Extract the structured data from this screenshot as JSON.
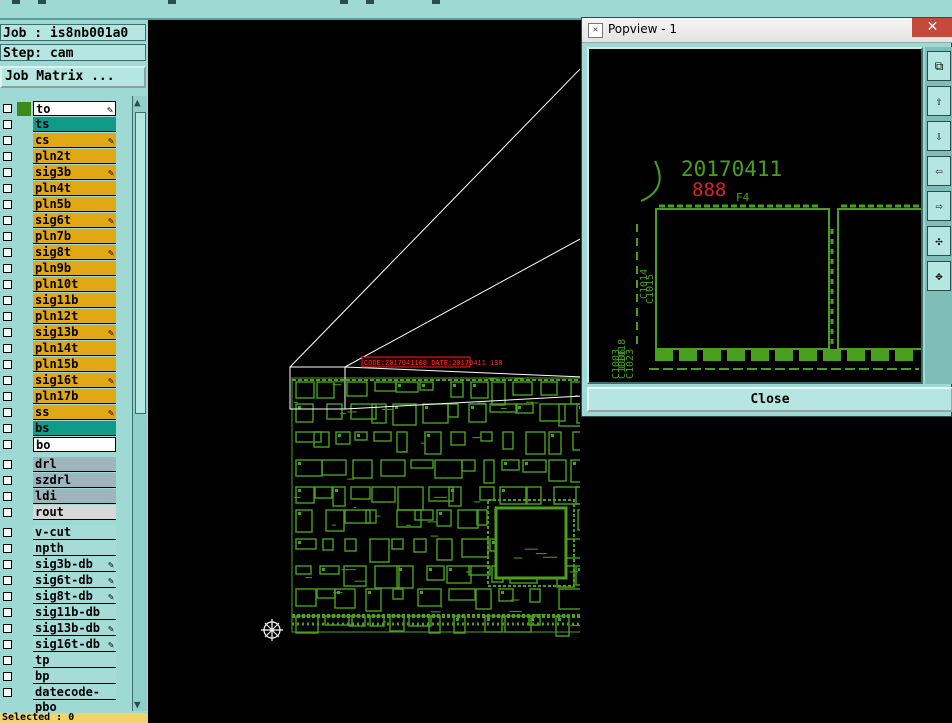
{
  "job_label": "Job : is8nb001a0",
  "step_label": "Step: cam",
  "job_matrix_button": "Job Matrix ...",
  "colors": {
    "panel": "#9fd9d4",
    "signal": "#e0a815",
    "teal": "#0f9a8a",
    "drill": "#9fb5bd",
    "board": "#a5dcd8",
    "pcb_green": "#4aa01e"
  },
  "layers": [
    {
      "name": "to",
      "style": "white",
      "swatch": "#3c8c1c",
      "pen": true
    },
    {
      "name": "ts",
      "style": "teal",
      "swatch": "",
      "pen": false
    },
    {
      "name": "cs",
      "style": "signal",
      "swatch": "",
      "pen": true
    },
    {
      "name": "pln2t",
      "style": "signal",
      "swatch": "",
      "pen": false
    },
    {
      "name": "sig3b",
      "style": "signal",
      "swatch": "",
      "pen": true
    },
    {
      "name": "pln4t",
      "style": "signal",
      "swatch": "",
      "pen": false
    },
    {
      "name": "pln5b",
      "style": "signal",
      "swatch": "",
      "pen": false
    },
    {
      "name": "sig6t",
      "style": "signal",
      "swatch": "",
      "pen": true
    },
    {
      "name": "pln7b",
      "style": "signal",
      "swatch": "",
      "pen": false
    },
    {
      "name": "sig8t",
      "style": "signal",
      "swatch": "",
      "pen": true
    },
    {
      "name": "pln9b",
      "style": "signal",
      "swatch": "",
      "pen": false
    },
    {
      "name": "pln10t",
      "style": "signal",
      "swatch": "",
      "pen": false
    },
    {
      "name": "sig11b",
      "style": "signal",
      "swatch": "",
      "pen": false
    },
    {
      "name": "pln12t",
      "style": "signal",
      "swatch": "",
      "pen": false
    },
    {
      "name": "sig13b",
      "style": "signal",
      "swatch": "",
      "pen": true
    },
    {
      "name": "pln14t",
      "style": "signal",
      "swatch": "",
      "pen": false
    },
    {
      "name": "pln15b",
      "style": "signal",
      "swatch": "",
      "pen": false
    },
    {
      "name": "sig16t",
      "style": "signal",
      "swatch": "",
      "pen": true
    },
    {
      "name": "pln17b",
      "style": "signal",
      "swatch": "",
      "pen": false
    },
    {
      "name": "ss",
      "style": "signal",
      "swatch": "",
      "pen": true
    },
    {
      "name": "bs",
      "style": "teal",
      "swatch": "",
      "pen": false
    },
    {
      "name": "bo",
      "style": "white",
      "swatch": "",
      "pen": false
    },
    {
      "gap": true
    },
    {
      "name": "drl",
      "style": "drill",
      "swatch": "",
      "pen": false
    },
    {
      "name": "szdrl",
      "style": "drill",
      "swatch": "",
      "pen": false
    },
    {
      "name": "ldi",
      "style": "drill",
      "swatch": "",
      "pen": false
    },
    {
      "name": "rout",
      "style": "light",
      "swatch": "",
      "pen": false
    },
    {
      "gap": true
    },
    {
      "name": "v-cut",
      "style": "board",
      "swatch": "",
      "pen": false
    },
    {
      "name": "npth",
      "style": "board",
      "swatch": "",
      "pen": false
    },
    {
      "name": "sig3b-db",
      "style": "board",
      "swatch": "",
      "pen": true
    },
    {
      "name": "sig6t-db",
      "style": "board",
      "swatch": "",
      "pen": true
    },
    {
      "name": "sig8t-db",
      "style": "board",
      "swatch": "",
      "pen": true
    },
    {
      "name": "sig11b-db",
      "style": "board",
      "swatch": "",
      "pen": false
    },
    {
      "name": "sig13b-db",
      "style": "board",
      "swatch": "",
      "pen": true
    },
    {
      "name": "sig16t-db",
      "style": "board",
      "swatch": "",
      "pen": true
    },
    {
      "name": "tp",
      "style": "board",
      "swatch": "",
      "pen": false
    },
    {
      "name": "bp",
      "style": "board",
      "swatch": "",
      "pen": false
    },
    {
      "name": "datecode-pbo",
      "style": "board",
      "swatch": "",
      "pen": false
    }
  ],
  "status_text": "Selected : 0",
  "popview": {
    "title": "Popview - 1",
    "close_x": "✕",
    "close_button": "Close",
    "date_code": "20170411",
    "red_code": "888",
    "f4_label": "F4",
    "side_labels": [
      "C1014",
      "C1015",
      "C1018",
      "C1006",
      "C1023",
      "C1003"
    ],
    "tools": [
      "zoom-fit-icon",
      "move-up-icon",
      "move-down-icon",
      "move-left-icon",
      "move-right-icon",
      "fit-window-icon",
      "pan-icon"
    ]
  },
  "pcb": {
    "red_label": "CODE:2017041108 DATE:20170411 1S8"
  }
}
